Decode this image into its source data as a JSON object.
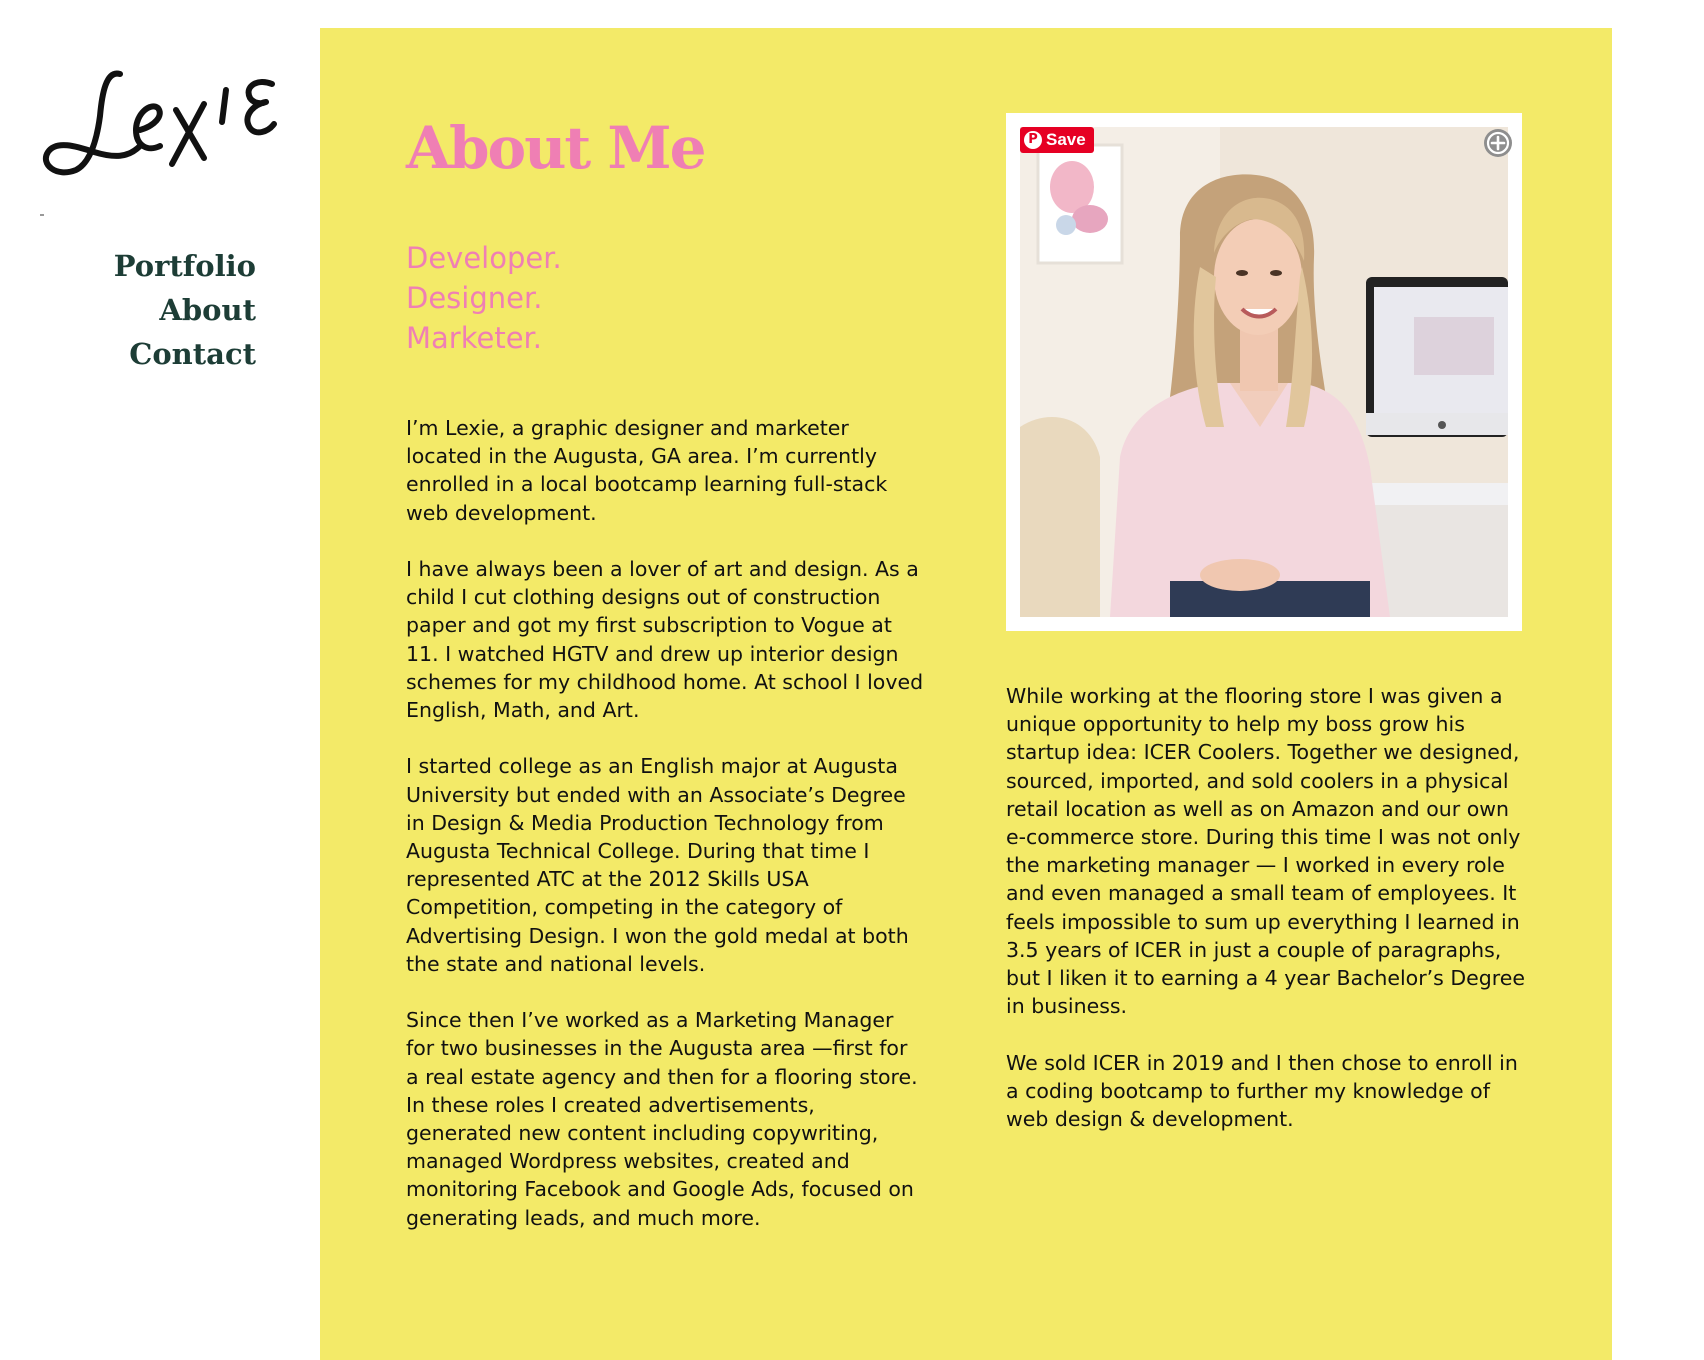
{
  "brand": {
    "logo_text": "Lexie"
  },
  "nav": {
    "items": [
      {
        "label": "Portfolio"
      },
      {
        "label": "About"
      },
      {
        "label": "Contact"
      }
    ]
  },
  "main": {
    "title": "About Me",
    "taglines": [
      "Developer.",
      "Designer.",
      "Marketer."
    ],
    "left_paragraphs": [
      "I’m Lexie, a graphic designer and marketer located in the Augusta, GA area. I’m currently enrolled in a local bootcamp learning full-stack web development.",
      "I have always been a lover of art and design. As a child I cut clothing designs out of construction paper and got my first subscription to Vogue at 11. I watched HGTV and drew up interior design schemes for my childhood home. At school I loved English, Math, and Art.",
      "I started college as an English major at Augusta University but ended with an Associate’s Degree in Design & Media Production Technology from Augusta Technical College. During that time I represented ATC at the 2012 Skills USA Competition, competing in the category of Advertising Design. I won the gold medal at both the state and national levels.",
      "Since then I’ve worked as a Marketing Manager for two businesses in the Augusta area —first for a real estate agency and then for a flooring store. In these roles I created advertisements, generated new content including copywriting, managed Wordpress websites, created and monitoring Facebook and Google Ads, focused on generating leads, and much more."
    ],
    "right_paragraphs": [
      "While working at the flooring store I was given a unique opportunity to help my boss grow his startup idea: ICER Coolers. Together we designed, sourced, imported, and sold coolers in a physical retail location as well as on Amazon and our own e-commerce store. During this time I was not only the marketing manager — I worked in every role and even managed a small team of employees. It feels impossible to sum up everything I learned in 3.5 years of ICER in just a couple of paragraphs, but I liken it to earning a 4 year Bachelor’s Degree in business.",
      "We sold ICER in 2019 and I then chose to enroll in a coding bootcamp to further my knowledge of web design & development."
    ]
  },
  "photo": {
    "pinterest_save_label": "Save",
    "pinterest_icon": "pinterest-logo-icon",
    "expand_icon": "expand-icon"
  },
  "colors": {
    "panel_background": "#f3ea68",
    "accent_pink": "#ef7fb4",
    "nav_text": "#1d3d36",
    "body_text": "#111111",
    "pinterest_red": "#e60023"
  }
}
